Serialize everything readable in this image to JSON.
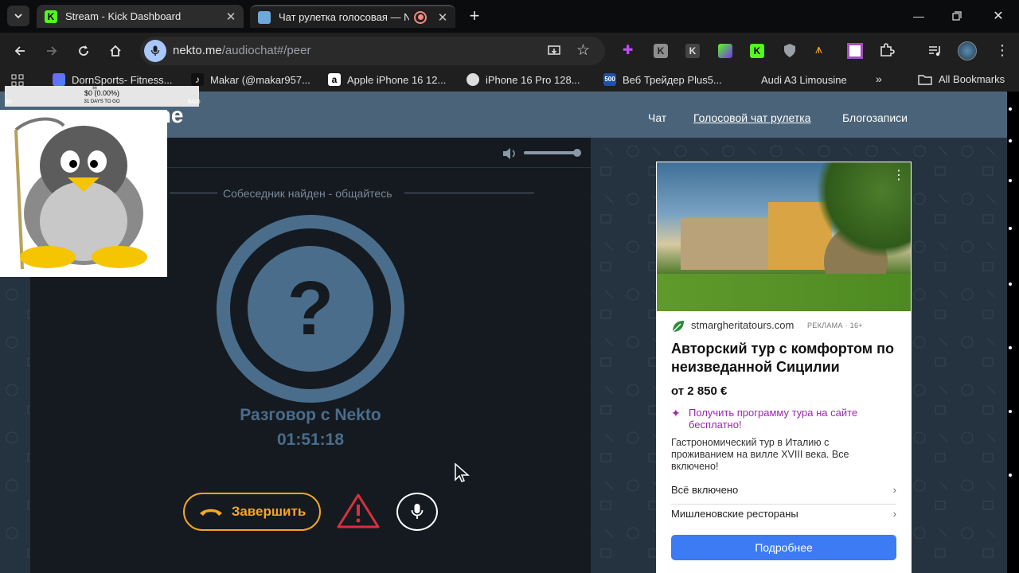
{
  "tabs": [
    {
      "title": "Stream - Kick Dashboard",
      "close": "✕"
    },
    {
      "title": "Чат рулетка голосовая — N",
      "close": "✕"
    }
  ],
  "address": {
    "domain": "nekto.me",
    "path": "/audiochat#/peer"
  },
  "bookmarks": [
    {
      "label": "DornSports- Fitness..."
    },
    {
      "label": "Makar (@makar957..."
    },
    {
      "label": "Apple iPhone 16 12..."
    },
    {
      "label": "iPhone 16 Pro 128..."
    },
    {
      "label": "Веб Трейдер Plus5..."
    },
    {
      "label": "Audi A3 Limousine"
    }
  ],
  "all_bookmarks": "All Bookmarks",
  "overlay": {
    "top_label": "$0 (0.00%)",
    "left_value": "$0",
    "mid_label": "31 DAYS TO GO",
    "right_value": "$400",
    "tiny": "Ⓜ"
  },
  "site": {
    "logo": "me",
    "nav": [
      "Чат",
      "Голосовой чат рулетка",
      "Блогозаписи"
    ]
  },
  "chat": {
    "status": "Собеседник найден - общайтесь",
    "title": "Разговор с Nekto",
    "timer": "01:51:18",
    "hangup": "Завершить",
    "volume_level": 0.95
  },
  "ad": {
    "domain": "stmargheritatours.com",
    "marker": "РЕКЛАМА · 16+",
    "headline": "Авторский тур с комфортом по неизведанной Сицилии",
    "price": "от 2 850 €",
    "cta_link": "Получить программу тура на сайте бесплатно!",
    "description": "Гастрономический тур в Италию с проживанием на вилле XVIII века. Все включено!",
    "items": [
      "Всё включено",
      "Мишленовские рестораны"
    ],
    "button": "Подробнее"
  },
  "colors": {
    "accent_orange": "#f5a623",
    "header_blue": "#4a6378",
    "panel": "#141a20",
    "ring": "#4a6d8c",
    "ad_button": "#3d7bf5"
  }
}
